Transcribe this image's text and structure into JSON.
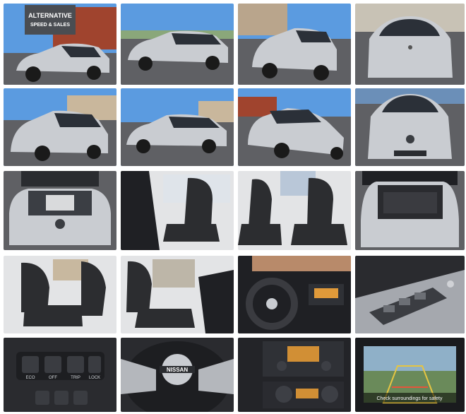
{
  "photos": [
    {
      "id": "front-left-exterior",
      "sign_text_line1": "ALTERNATIVE",
      "sign_text_line2": "SPEED & SALES"
    },
    {
      "id": "left-side-exterior"
    },
    {
      "id": "rear-left-exterior"
    },
    {
      "id": "rear-exterior"
    },
    {
      "id": "rear-left-exterior-2"
    },
    {
      "id": "left-profile-exterior"
    },
    {
      "id": "front-right-exterior"
    },
    {
      "id": "front-exterior"
    },
    {
      "id": "open-hood-engine"
    },
    {
      "id": "driver-seat-interior"
    },
    {
      "id": "front-seats-interior"
    },
    {
      "id": "open-trunk-cargo"
    },
    {
      "id": "rear-seats-interior"
    },
    {
      "id": "passenger-seat-interior"
    },
    {
      "id": "steering-dashboard"
    },
    {
      "id": "window-switch-panel"
    },
    {
      "id": "console-buttons",
      "button_labels": [
        "ECO",
        "OFF",
        "TRIP",
        "LOCK"
      ]
    },
    {
      "id": "steering-wheel-logo",
      "logo_text": "NISSAN"
    },
    {
      "id": "radio-console"
    },
    {
      "id": "backup-camera-screen",
      "screen_text": "Check surroundings for safety"
    }
  ]
}
